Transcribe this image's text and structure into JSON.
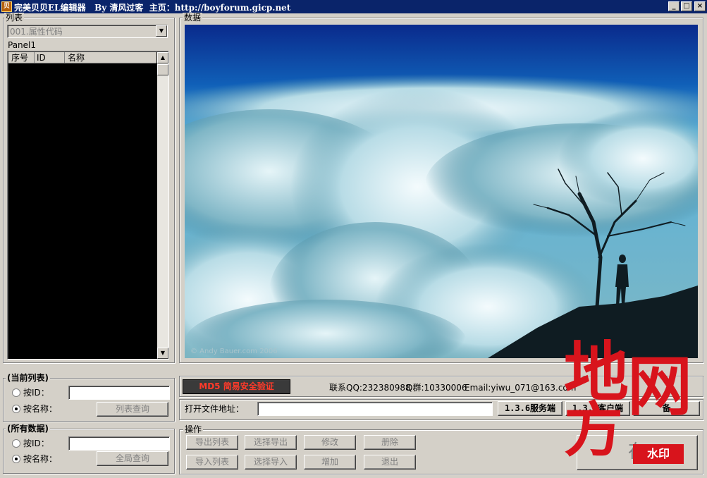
{
  "window": {
    "app_icon_text": "贝",
    "title": "完美贝贝EL编辑器   By 清风过客  主页：http://boyforum.gicp.net",
    "minimize": "_",
    "maximize": "□",
    "close": "×"
  },
  "list_panel": {
    "label": "列表",
    "combo_value": "001.属性代码",
    "panel_caption": "Panel1",
    "columns": [
      "序号",
      "ID",
      "名称"
    ],
    "rows": []
  },
  "data_panel": {
    "label": "数据",
    "image_caption": "© Andy Bauer.com 2006"
  },
  "current_list": {
    "label": "(当前列表)",
    "radio_id_label": "按ID：",
    "radio_name_label": "按名称：",
    "radio_id_checked": false,
    "radio_name_checked": true,
    "id_value": "",
    "query_button": "列表查询"
  },
  "all_data": {
    "label": "(所有数据)",
    "radio_id_label": "按ID：",
    "radio_name_label": "按名称：",
    "radio_id_checked": false,
    "radio_name_checked": true,
    "id_value": "",
    "query_button": "全局查询"
  },
  "info_bar": {
    "md5_badge": "MD5 简易安全验证",
    "contact_qq": "联系QQ:232380988",
    "group_q": "Q群:10330006",
    "email": "Email:yiwu_071@163.com"
  },
  "file_bar": {
    "open_label": "打开文件地址：",
    "path_value": "",
    "server_button": "1.3.6服务端",
    "client_button": "1.3.6客户端",
    "extra_button": "备"
  },
  "operations": {
    "label": "操作",
    "buttons_row1": [
      "导出列表",
      "选择导出",
      "修改",
      "册除"
    ],
    "buttons_row2": [
      "导入列表",
      "选择导入",
      "增加",
      "退出"
    ],
    "save_button": "存"
  },
  "watermark": {
    "chars": [
      "地",
      "网",
      "方"
    ],
    "stamp": "水印"
  },
  "colors": {
    "titlebar": "#0a246a",
    "face": "#d4d0c8",
    "watermark_red": "#d8141c"
  }
}
